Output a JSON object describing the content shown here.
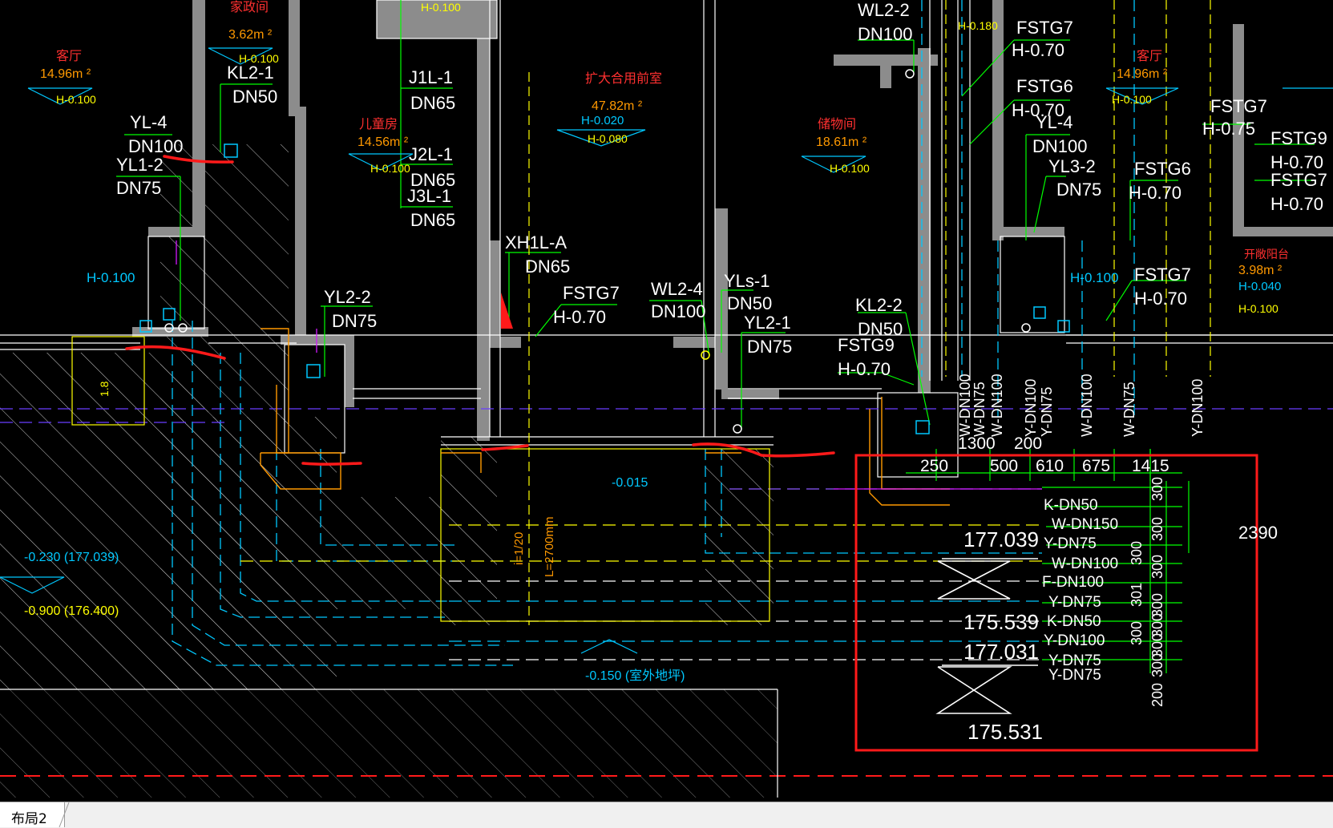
{
  "layout_tabs": [
    {
      "label": "布局2"
    }
  ],
  "room_labels": [
    {
      "name": "家政间",
      "area": "3.62m ²",
      "elev": "H-0.100"
    },
    {
      "name": "客厅",
      "area": "14.96m ²",
      "elev": "H-0.100"
    },
    {
      "name": "儿童房",
      "area": "14.56m ²",
      "elev": "H-0.100"
    },
    {
      "name": "扩大合用前室",
      "area": "47.82m ²",
      "elev1": "H-0.020",
      "elev2": "H-0.080"
    },
    {
      "name": "储物间",
      "area": "18.61m ²",
      "elev": "H-0.100"
    },
    {
      "name": "客厅",
      "area": "14.96m ²",
      "elev": "H-0.100"
    },
    {
      "name": "开敞阳台",
      "area": "3.98m ²",
      "elev1": "H-0.040",
      "elev2": "H-0.100"
    }
  ],
  "pipe_labels": [
    {
      "id": "kl21_a",
      "t1": "KL2-1",
      "t2": "DN50"
    },
    {
      "id": "yl4_a",
      "t1": "YL-4",
      "t2": "DN100"
    },
    {
      "id": "yl12",
      "t1": "YL1-2",
      "t2": "DN75"
    },
    {
      "id": "j1l1",
      "t1": "J1L-1",
      "t2": "DN65"
    },
    {
      "id": "j2l1",
      "t1": "J2L-1",
      "t2": "DN65"
    },
    {
      "id": "j3l1",
      "t1": "J3L-1",
      "t2": "DN65"
    },
    {
      "id": "xh1l",
      "t1": "XH1L-A",
      "t2": "DN65"
    },
    {
      "id": "fstg7_a",
      "t1": "FSTG7",
      "t2": "H-0.70"
    },
    {
      "id": "yl22",
      "t1": "YL2-2",
      "t2": "DN75"
    },
    {
      "id": "wl24",
      "t1": "WL2-4",
      "t2": "DN100"
    },
    {
      "id": "yls1",
      "t1": "YLs-1",
      "t2": "DN50"
    },
    {
      "id": "yl21",
      "t1": "YL2-1",
      "t2": "DN75"
    },
    {
      "id": "kl22",
      "t1": "KL2-2",
      "t2": "DN50"
    },
    {
      "id": "fstg9_a",
      "t1": "FSTG9",
      "t2": "H-0.70"
    },
    {
      "id": "wl22",
      "t1": "WL2-2",
      "t2": "DN100"
    },
    {
      "id": "fstg7_b",
      "t1": "FSTG7",
      "t2": "H-0.70"
    },
    {
      "id": "fstg6_a",
      "t1": "FSTG6",
      "t2": "H-0.70"
    },
    {
      "id": "yl4_b",
      "t1": "YL-4",
      "t2": "DN100"
    },
    {
      "id": "yl32",
      "t1": "YL3-2",
      "t2": "DN75"
    },
    {
      "id": "fstg6_b",
      "t1": "FSTG6",
      "t2": "H-0.70"
    },
    {
      "id": "fstg7_c",
      "t1": "FSTG7",
      "t2": "H-0.75"
    },
    {
      "id": "fstg9_b",
      "t1": "FSTG9",
      "t2": "H-0.70"
    },
    {
      "id": "fstg7_d",
      "t1": "FSTG7",
      "t2": "H-0.70"
    },
    {
      "id": "fstg7_e",
      "t1": "FSTG7",
      "t2": "H-0.70"
    }
  ],
  "misc_labels": {
    "h0100_left": "H-0.100",
    "h0100_right": "H-0.100",
    "top_h0100": "H-0.100",
    "top_h0180": "H-0.180",
    "left_elev1": "-0.230  (177.039)",
    "left_elev2": "-0.900  (176.400)",
    "door_elev": "-0.015",
    "outdoor": "-0.150  (室外地坪)",
    "slope": "i=1/20",
    "length": "L=2700mm",
    "dim_18": "1.8"
  },
  "vertical_pipe_labels": [
    "W-DN100",
    "W-DN75",
    "W-DN100",
    "Y-DN100",
    "Y-DN75",
    "W-DN100",
    "W-DN75",
    "Y-DN100"
  ],
  "detail_box": {
    "dims_top": [
      "1300",
      "200",
      "250",
      "500",
      "610",
      "675",
      "1415"
    ],
    "pipes": [
      "K-DN50",
      "W-DN150",
      "Y-DN75",
      "W-DN100",
      "F-DN100",
      "Y-DN75",
      "K-DN50",
      "Y-DN100",
      "Y-DN75",
      "Y-DN75"
    ],
    "spacing_right": [
      "300",
      "300",
      "300",
      "300",
      "300",
      "300",
      "300",
      "200"
    ],
    "spacing_mid": [
      "300",
      "301",
      "300"
    ],
    "total": "2390",
    "elevations": [
      "177.039",
      "175.539",
      "177.031",
      "175.531"
    ]
  },
  "colors": {
    "wall": "#8c8c8c",
    "green": "#00ff00",
    "yellow": "#ffff00",
    "white": "#ffffff",
    "cyan": "#00c8ff",
    "blue": "#0066ff",
    "red_marker": "#ff1a1a",
    "orange": "#ff9900",
    "magenta": "#d21aff",
    "purple": "#6a3cff",
    "redtext": "#ff3030",
    "hatch": "#c8c8c8"
  }
}
